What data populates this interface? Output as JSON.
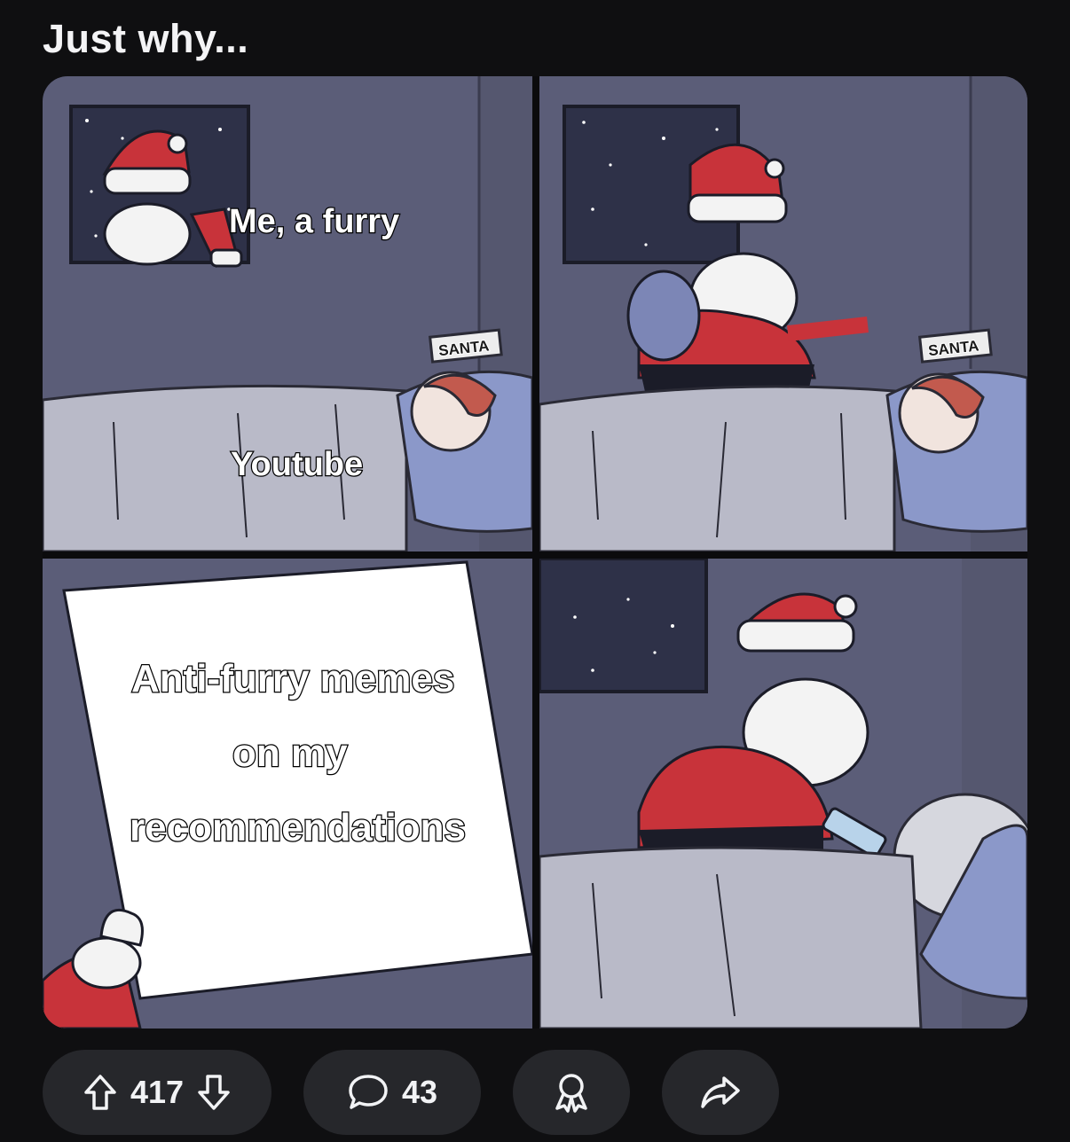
{
  "post": {
    "title": "Just why..."
  },
  "meme": {
    "panel1_caption_top": "Me, a furry",
    "panel1_caption_bottom": "Youtube",
    "sign_text": "SANTA",
    "letter_lines": [
      "Anti-furry memes",
      "on my",
      "recommendations"
    ]
  },
  "actions": {
    "upvote_count": "417",
    "comment_count": "43",
    "icons": {
      "upvote": "arrow-up-icon",
      "downvote": "arrow-down-icon",
      "comment": "speech-bubble-icon",
      "award": "award-ribbon-icon",
      "share": "share-arrow-icon"
    }
  },
  "colors": {
    "background": "#0f0f11",
    "pill": "#26272b",
    "wall": "#5b5d78",
    "santa_red": "#c8333a"
  }
}
